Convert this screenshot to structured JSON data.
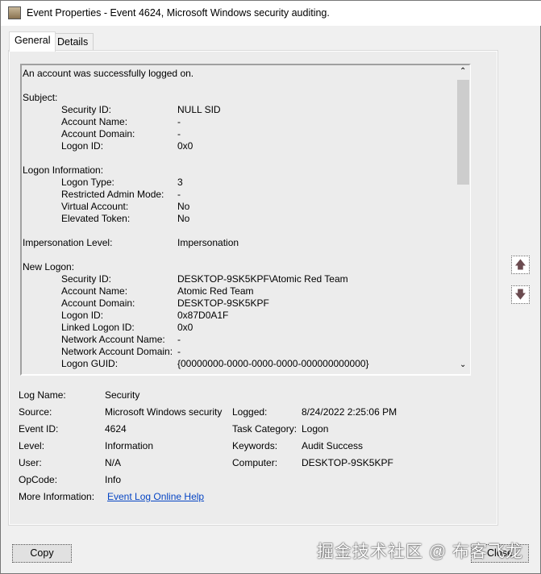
{
  "window": {
    "title": "Event Properties - Event 4624, Microsoft Windows security auditing."
  },
  "tabs": [
    {
      "label": "General"
    },
    {
      "label": "Details"
    }
  ],
  "description": [
    {
      "label": "An account was successfully logged on.",
      "indent": false,
      "value": ""
    },
    {
      "label": "",
      "indent": false,
      "value": ""
    },
    {
      "label": "Subject:",
      "indent": false,
      "value": ""
    },
    {
      "label": "Security ID:",
      "indent": true,
      "value": "NULL SID"
    },
    {
      "label": "Account Name:",
      "indent": true,
      "value": "-"
    },
    {
      "label": "Account Domain:",
      "indent": true,
      "value": "-"
    },
    {
      "label": "Logon ID:",
      "indent": true,
      "value": "0x0"
    },
    {
      "label": "",
      "indent": false,
      "value": ""
    },
    {
      "label": "Logon Information:",
      "indent": false,
      "value": ""
    },
    {
      "label": "Logon Type:",
      "indent": true,
      "value": "3"
    },
    {
      "label": "Restricted Admin Mode:",
      "indent": true,
      "value": "-"
    },
    {
      "label": "Virtual Account:",
      "indent": true,
      "value": "No"
    },
    {
      "label": "Elevated Token:",
      "indent": true,
      "value": "No"
    },
    {
      "label": "",
      "indent": false,
      "value": ""
    },
    {
      "label": "Impersonation Level:",
      "indent": false,
      "value": "Impersonation"
    },
    {
      "label": "",
      "indent": false,
      "value": ""
    },
    {
      "label": "New Logon:",
      "indent": false,
      "value": ""
    },
    {
      "label": "Security ID:",
      "indent": true,
      "value": "DESKTOP-9SK5KPF\\Atomic Red Team"
    },
    {
      "label": "Account Name:",
      "indent": true,
      "value": "Atomic Red Team"
    },
    {
      "label": "Account Domain:",
      "indent": true,
      "value": "DESKTOP-9SK5KPF"
    },
    {
      "label": "Logon ID:",
      "indent": true,
      "value": "0x87D0A1F"
    },
    {
      "label": "Linked Logon ID:",
      "indent": true,
      "value": "0x0"
    },
    {
      "label": "Network Account Name:",
      "indent": true,
      "value": "-"
    },
    {
      "label": "Network Account Domain:",
      "indent": true,
      "value": "-"
    },
    {
      "label": "Logon GUID:",
      "indent": true,
      "value": "{00000000-0000-0000-0000-000000000000}"
    }
  ],
  "fields": {
    "log_name": {
      "label": "Log Name:",
      "value": "Security"
    },
    "source": {
      "label": "Source:",
      "value": "Microsoft Windows security"
    },
    "logged": {
      "label": "Logged:",
      "value": "8/24/2022 2:25:06 PM"
    },
    "event_id": {
      "label": "Event ID:",
      "value": "4624"
    },
    "task_category": {
      "label": "Task Category:",
      "value": "Logon"
    },
    "level": {
      "label": "Level:",
      "value": "Information"
    },
    "keywords": {
      "label": "Keywords:",
      "value": "Audit Success"
    },
    "user": {
      "label": "User:",
      "value": "N/A"
    },
    "computer": {
      "label": "Computer:",
      "value": "DESKTOP-9SK5KPF"
    },
    "opcode": {
      "label": "OpCode:",
      "value": "Info"
    },
    "more_info": {
      "label": "More Information:",
      "value": "Event Log Online Help"
    }
  },
  "buttons": {
    "copy": "Copy",
    "close": "Close"
  },
  "watermark": "掘金技术社区 @ 布客飞龙"
}
